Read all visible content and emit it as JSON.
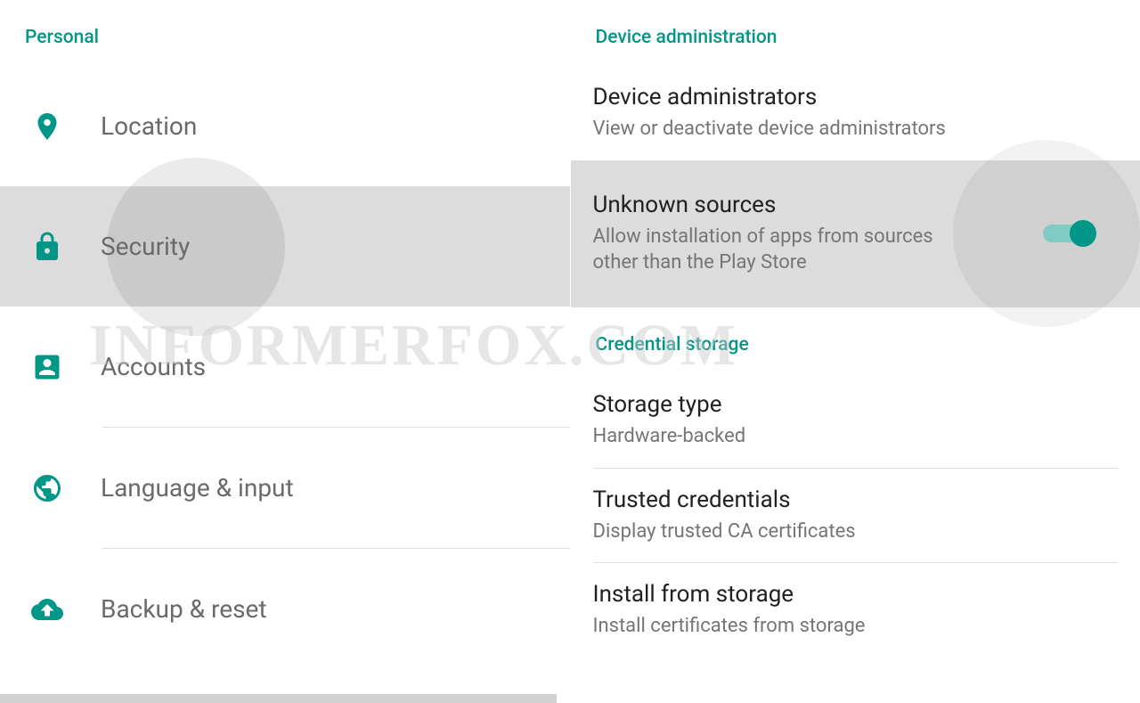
{
  "colors": {
    "accent": "#009688"
  },
  "left": {
    "section": "Personal",
    "items": [
      {
        "label": "Location",
        "icon": "location-icon"
      },
      {
        "label": "Security",
        "icon": "lock-icon",
        "selected": true
      },
      {
        "label": "Accounts",
        "icon": "account-icon"
      },
      {
        "label": "Language & input",
        "icon": "globe-icon"
      },
      {
        "label": "Backup & reset",
        "icon": "backup-icon"
      }
    ]
  },
  "right": {
    "sections": [
      {
        "header": "Device administration",
        "items": [
          {
            "title": "Device administrators",
            "sub": "View or deactivate device administrators"
          },
          {
            "title": "Unknown sources",
            "sub": "Allow installation of apps from sources other than the Play Store",
            "toggle": true,
            "highlighted": true
          }
        ]
      },
      {
        "header": "Credential storage",
        "items": [
          {
            "title": "Storage type",
            "sub": "Hardware-backed"
          },
          {
            "title": "Trusted credentials",
            "sub": "Display trusted CA certificates"
          },
          {
            "title": "Install from storage",
            "sub": "Install certificates from storage"
          }
        ]
      }
    ]
  },
  "watermark": "INFORMERFOX.COM"
}
